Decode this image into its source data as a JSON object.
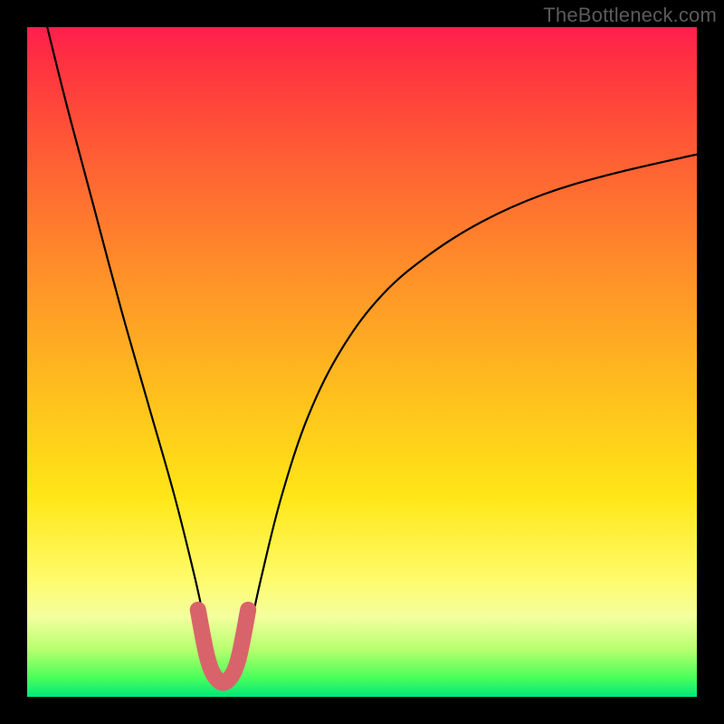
{
  "watermark": "TheBottleneck.com",
  "chart_data": {
    "type": "line",
    "title": "",
    "xlabel": "",
    "ylabel": "",
    "xlim": [
      0,
      100
    ],
    "ylim": [
      0,
      100
    ],
    "series": [
      {
        "name": "bottleneck-curve",
        "x": [
          3,
          6,
          10,
          14,
          18,
          22,
          25,
          27,
          28.5,
          30,
          31.5,
          33,
          35,
          38,
          42,
          47,
          53,
          60,
          68,
          77,
          87,
          100
        ],
        "values": [
          100,
          88,
          73,
          58,
          44,
          30,
          18,
          9,
          4,
          2,
          4,
          9,
          18,
          30,
          42,
          52,
          60,
          66,
          71,
          75,
          78,
          81
        ]
      },
      {
        "name": "highlight-segment",
        "x": [
          25.5,
          27,
          28.5,
          30,
          31.5,
          33
        ],
        "values": [
          13,
          5.5,
          2.5,
          2.5,
          5.5,
          13
        ]
      }
    ],
    "highlight_color": "#d9636b",
    "curve_color": "#000000"
  }
}
